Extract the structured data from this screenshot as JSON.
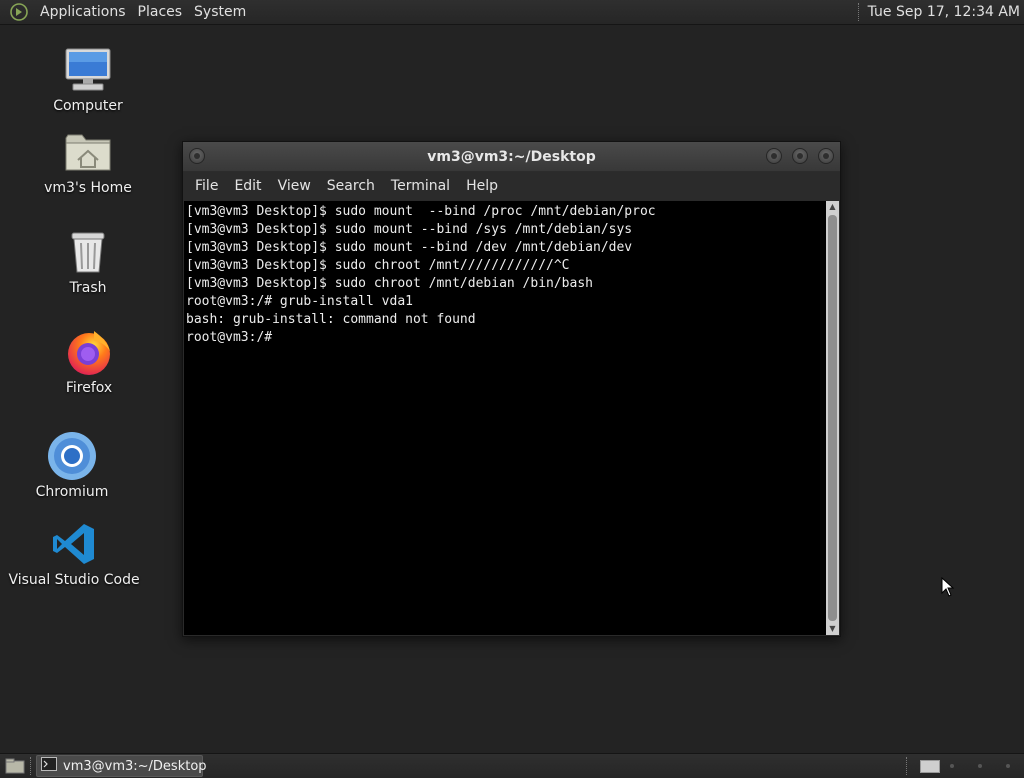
{
  "top_panel": {
    "menus": [
      "Applications",
      "Places",
      "System"
    ],
    "clock": "Tue Sep 17, 12:34 AM"
  },
  "desktop_icons": [
    {
      "label": "Computer",
      "icon": "computer-icon"
    },
    {
      "label": "vm3's Home",
      "icon": "home-folder-icon"
    },
    {
      "label": "Trash",
      "icon": "trash-icon"
    },
    {
      "label": "Firefox",
      "icon": "firefox-icon"
    },
    {
      "label": "Chromium",
      "icon": "chromium-icon"
    },
    {
      "label": "Visual Studio Code",
      "icon": "vscode-icon"
    }
  ],
  "terminal": {
    "title": "vm3@vm3:~/Desktop",
    "menu": [
      "File",
      "Edit",
      "View",
      "Search",
      "Terminal",
      "Help"
    ],
    "lines": [
      "[vm3@vm3 Desktop]$ sudo mount  --bind /proc /mnt/debian/proc",
      "[vm3@vm3 Desktop]$ sudo mount --bind /sys /mnt/debian/sys",
      "[vm3@vm3 Desktop]$ sudo mount --bind /dev /mnt/debian/dev",
      "[vm3@vm3 Desktop]$ sudo chroot /mnt////////////^C",
      "[vm3@vm3 Desktop]$ sudo chroot /mnt/debian /bin/bash",
      "root@vm3:/# grub-install vda1",
      "bash: grub-install: command not found",
      "root@vm3:/#"
    ]
  },
  "taskbar": {
    "window_label": "vm3@vm3:~/Desktop"
  },
  "colors": {
    "desktop_bg": "#232323",
    "panel_bg": "#2b2b2b",
    "terminal_bg": "#000000",
    "terminal_fg": "#ededed"
  }
}
